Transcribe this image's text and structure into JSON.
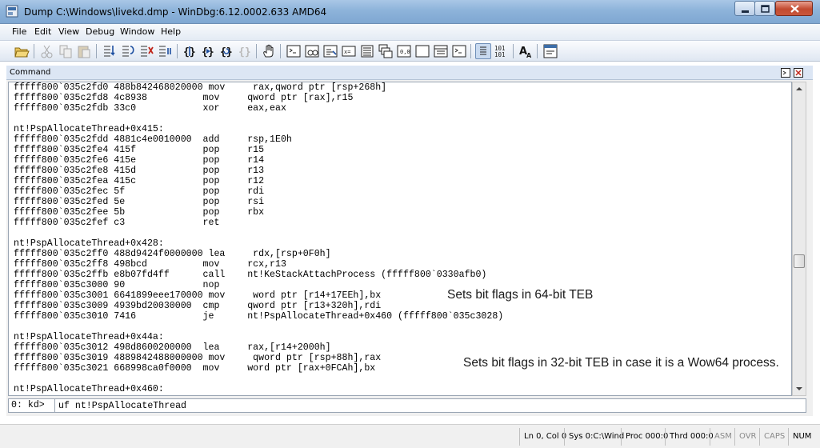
{
  "window": {
    "title": "Dump C:\\Windows\\livekd.dmp - WinDbg:6.12.0002.633 AMD64"
  },
  "menu": [
    "File",
    "Edit",
    "View",
    "Debug",
    "Window",
    "Help"
  ],
  "toolbar": {
    "buttons": [
      "open-icon",
      "cut-icon",
      "copy-icon",
      "paste-icon",
      "step-into-icon",
      "step-over-icon",
      "step-out-icon",
      "run-to-cursor-icon",
      "break-icon",
      "go-icon",
      "restart-icon",
      "stop-icon",
      "hand-icon",
      "command-icon",
      "watch-icon",
      "locals-icon",
      "registers-icon",
      "memory-icon",
      "call-stack-icon",
      "disassembly-icon",
      "scratch-pad-icon",
      "processes-icon",
      "source-mode-icon",
      "hex-icon",
      "font-icon",
      "options-icon"
    ]
  },
  "command_window": {
    "title": "Command",
    "lines": [
      "fffff800`035c2fd0 488b842468020000 mov     rax,qword ptr [rsp+268h]",
      "fffff800`035c2fd8 4c8938          mov     qword ptr [rax],r15",
      "fffff800`035c2fdb 33c0            xor     eax,eax",
      "",
      "nt!PspAllocateThread+0x415:",
      "fffff800`035c2fdd 4881c4e0010000  add     rsp,1E0h",
      "fffff800`035c2fe4 415f            pop     r15",
      "fffff800`035c2fe6 415e            pop     r14",
      "fffff800`035c2fe8 415d            pop     r13",
      "fffff800`035c2fea 415c            pop     r12",
      "fffff800`035c2fec 5f              pop     rdi",
      "fffff800`035c2fed 5e              pop     rsi",
      "fffff800`035c2fee 5b              pop     rbx",
      "fffff800`035c2fef c3              ret",
      "",
      "nt!PspAllocateThread+0x428:",
      "fffff800`035c2ff0 488d9424f0000000 lea     rdx,[rsp+0F0h]",
      "fffff800`035c2ff8 498bcd          mov     rcx,r13",
      "fffff800`035c2ffb e8b07fd4ff      call    nt!KeStackAttachProcess (fffff800`0330afb0)",
      "fffff800`035c3000 90              nop",
      "fffff800`035c3001 6641899eee170000 mov     word ptr [r14+17EEh],bx",
      "fffff800`035c3009 4939bd20030000  cmp     qword ptr [r13+320h],rdi",
      "fffff800`035c3010 7416            je      nt!PspAllocateThread+0x460 (fffff800`035c3028)",
      "",
      "nt!PspAllocateThread+0x44a:",
      "fffff800`035c3012 498d8600200000  lea     rax,[r14+2000h]",
      "fffff800`035c3019 4889842488000000 mov     qword ptr [rsp+88h],rax",
      "fffff800`035c3021 668998ca0f0000  mov     word ptr [rax+0FCAh],bx",
      "",
      "nt!PspAllocateThread+0x460:"
    ],
    "notes": {
      "teb64": "Sets bit flags in 64-bit TEB",
      "teb32": "Sets bit flags in 32-bit TEB in case it is a Wow64 process."
    },
    "prompt": "0: kd>",
    "input_value": "uf nt!PspAllocateThread"
  },
  "status": {
    "position": "Ln 0, Col 0",
    "sys": "Sys 0:C:\\Wind",
    "proc": "Proc 000:0",
    "thrd": "Thrd 000:0",
    "asm": "ASM",
    "ovr": "OVR",
    "caps": "CAPS",
    "num": "NUM"
  }
}
